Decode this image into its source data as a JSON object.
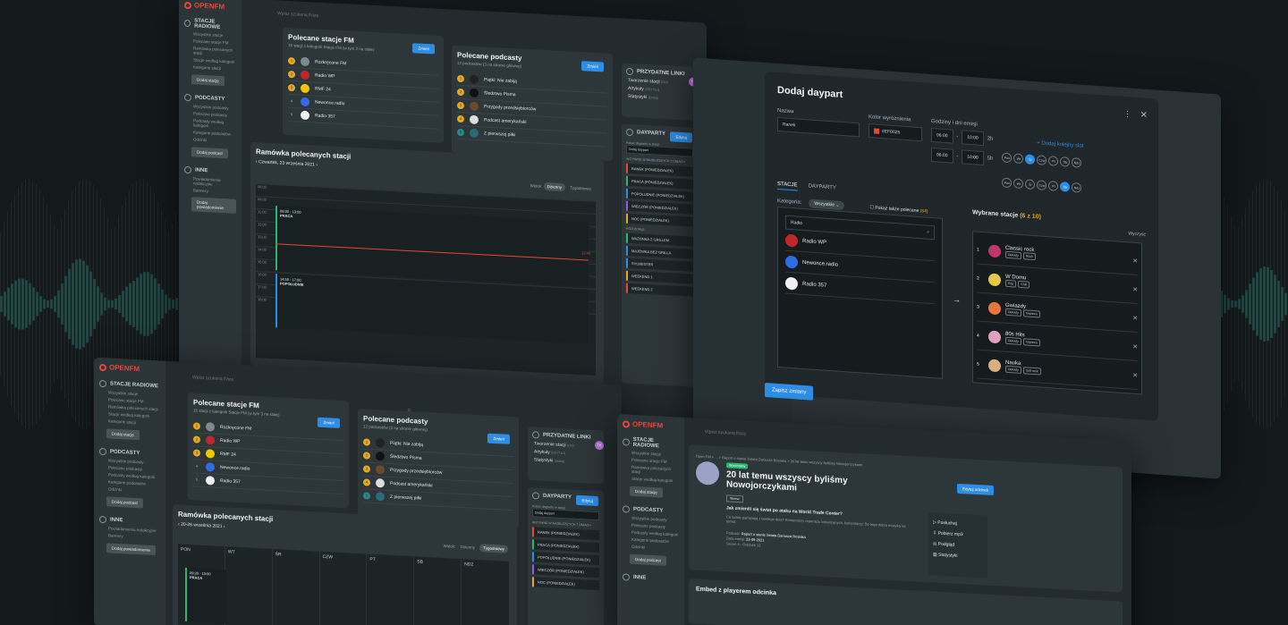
{
  "colors": {
    "accent": "#2e8de6",
    "brand": "#e8463a",
    "rank": "#e5a826",
    "bg": "#141a1c"
  },
  "app": {
    "logo": "OPENFM",
    "search_placeholder": "Wpisz szukaną frazę"
  },
  "sidebar": {
    "stations_title": "STACJE RADIOWE",
    "stations_links": [
      "Wszystkie stacje",
      "Polecane stacje FM",
      "Ramówka polecanych stacji",
      "Stacje według kategorii",
      "Kategorie stacji"
    ],
    "add_station": "Dodaj stację",
    "podcasts_title": "PODCASTY",
    "podcasts_links": [
      "Wszystkie podcasty",
      "Polecane podcasty",
      "Podcasty według kategorii",
      "Kategorie podcastów",
      "Odcinki"
    ],
    "add_podcast": "Dodaj podcast",
    "other_title": "INNE",
    "other_links": [
      "Powiadomienia redakcyjne",
      "Bannery"
    ],
    "add_notification": "Dodaj powiadomienie"
  },
  "fm_card": {
    "title": "Polecane stacje FM",
    "subtitle": "15 stacji z kategorii Stacje FM (w tym 3 na stałe)",
    "edit": "Zmień",
    "items": [
      "Rozkręcone FM",
      "Radio WP",
      "RMF 24",
      "Newonce.radio",
      "Radio 357"
    ]
  },
  "podcast_card": {
    "title": "Polecane podcasty",
    "subtitle": "12 podcastów (3 na stronie głównej)",
    "edit": "Zmień",
    "items": [
      "Piątki: Nie zabiją",
      "Śledztwo Pisma",
      "Przygody przedsiębiorców",
      "Podcast amerykański",
      "Z pierwszej piłki"
    ]
  },
  "links_card": {
    "title": "PRZYDATNE LINKI",
    "items": [
      "Tworzenie stacji",
      "Artykuły",
      "Statystyki"
    ],
    "hints": [
      "(Ctrl)",
      "(EDYTUJ)",
      "(Dodaj)"
    ]
  },
  "dayparts_card": {
    "title": "DAYPARTY",
    "edit": "Edytuj",
    "search_label": "Pokaż daypartu w stacji",
    "search_placeholder": "Dodaj daypart",
    "active_label": "AKTYWNE W NAJBLIŻSZYCH 7 DNIACH",
    "items": [
      "RANEK (PONIEDZIAŁEK)",
      "PRACA (PONIEDZIAŁEK)",
      "POPOŁUDNIE (PONIEDZIAŁEK)",
      "WIECZÓR (PONIEDZIAŁEK)",
      "NOC (PONIEDZIAŁEK)"
    ],
    "upcoming_label": "POZOSTAŁE",
    "upcoming": [
      "WAŻONKA Z GRILLEM",
      "MAJÓWKA BEZ GRILLA",
      "SYLWESTER",
      "WEEKEND 1",
      "WEEKEND 2"
    ]
  },
  "schedule": {
    "title": "Ramówka polecanych stacji",
    "date": "Czwartek, 23 września 2021",
    "view_label": "Widok:",
    "view_day": "Dzienny",
    "view_week": "Tygodniowy",
    "hours": [
      "06:00",
      "09:00",
      "11:00",
      "12:00",
      "13:00",
      "14:00",
      "15:00",
      "16:00",
      "17:00",
      "18:00"
    ],
    "block1_time": "09:30 - 13:00",
    "block1_name": "PRACA",
    "block2_time": "14:50 - 17:00",
    "block2_name": "POPOŁUDNIE",
    "now": "12:40"
  },
  "week_schedule": {
    "date": "20-26 września 2021",
    "days": [
      "PON",
      "WT",
      "ŚR",
      "CZW",
      "PT",
      "SB",
      "NDZ"
    ]
  },
  "modal": {
    "title": "Dodaj daypart",
    "name_label": "Nazwa",
    "name_value": "Ranek",
    "color_label": "Kolor wyróżnienia",
    "color_value": "#EF0025",
    "hours_label": "Godziny i dni emisji",
    "slots": [
      {
        "from": "06:00",
        "to": "10:00",
        "len": "2h"
      },
      {
        "from": "06:00",
        "to": "10:00",
        "len": "5h"
      }
    ],
    "add_slot": "+ Dodaj kolejny slot",
    "days": [
      "Pon",
      "Wt",
      "Śr",
      "Czw",
      "Pt",
      "Sb",
      "Ndz"
    ],
    "tabs": [
      "STACJE",
      "DAYPARTY"
    ],
    "category_label": "Kategoria:",
    "category_value": "Wszystkie",
    "show_recommended": "Pokaż także polecane",
    "recommended_count": "(64)",
    "search_placeholder": "Radio",
    "results": [
      "Radio WP",
      "Newonce.radio",
      "Radio 357"
    ],
    "selected_title": "Wybrane stacje",
    "selected_count": "(6 z 10)",
    "clear": "Wyczyść",
    "selected": [
      {
        "n": "1",
        "name": "Classic rock",
        "tags": [
          "Dekady",
          "Rock"
        ]
      },
      {
        "n": "2",
        "name": "W Domu",
        "tags": [
          "Pop",
          "Chill"
        ]
      },
      {
        "n": "3",
        "name": "Gwiazdy",
        "tags": [
          "Dekady",
          "Impreza"
        ]
      },
      {
        "n": "4",
        "name": "80s Hits",
        "tags": [
          "Dekady",
          "Impreza"
        ]
      },
      {
        "n": "5",
        "name": "Nauka",
        "tags": [
          "Dekady",
          "Soft rock"
        ]
      }
    ],
    "save": "Zapisz zmiany"
  },
  "episode": {
    "breadcrumb": "Open FM > ... > Raport o stanie świata Dariusza Rosiaka > 20 lat temu wszyscy byliśmy Nowojorczykami",
    "badge": "Wyróżniony",
    "title": "20 lat temu wszyscy byliśmy Nowojorczykami",
    "edit": "Edytuj odcinek",
    "tag": "Wiersz",
    "question": "Jak zmienili się świat po ataku na World Trade Center?",
    "desc": "Co ludzie pamiętają z tamtego dnia? Komentarzy reportażu telewizyjnych, komentarzy. Do tego dobra muzyka na temat.",
    "podcast_label": "Podcast:",
    "podcast_value": "Raport o stanie świata Dariusza Rosiaka",
    "date_label": "Data emisji:",
    "date_value": "23-09-2021",
    "season": "Sezon 4 - Odcinek 12",
    "actions": [
      "Posłuchaj",
      "Pobierz mp3",
      "Podgląd",
      "Statystyki"
    ],
    "embed": "Embed z playerem odcinka"
  },
  "avatar": "TK"
}
